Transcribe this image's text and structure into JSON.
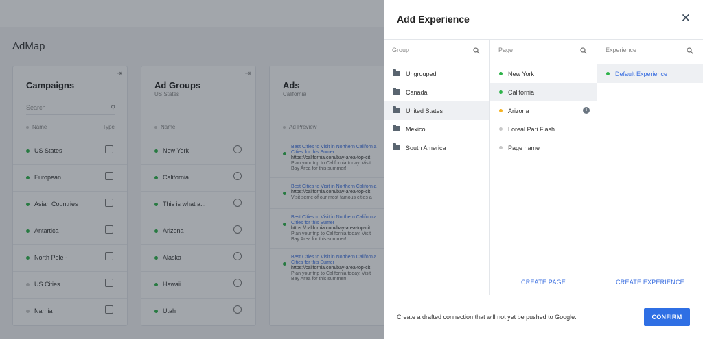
{
  "app": {
    "title": "AdMap"
  },
  "campaigns": {
    "title": "Campaigns",
    "search_placeholder": "Search",
    "col_name": "Name",
    "col_type": "Type",
    "rows": [
      {
        "label": "US States",
        "status": "#2eb34a"
      },
      {
        "label": "European",
        "status": "#2eb34a"
      },
      {
        "label": "Asian Countries",
        "status": "#2eb34a"
      },
      {
        "label": "Antartica",
        "status": "#2eb34a"
      },
      {
        "label": "North Pole -",
        "status": "#2eb34a"
      },
      {
        "label": "US Cities",
        "status": "#c8c8c8"
      },
      {
        "label": "Narnia",
        "status": "#c8c8c8"
      }
    ]
  },
  "ad_groups": {
    "title": "Ad Groups",
    "subtitle": "US States",
    "col_name": "Name",
    "rows": [
      {
        "label": "New York",
        "status": "#2eb34a"
      },
      {
        "label": "California",
        "status": "#2eb34a"
      },
      {
        "label": "This is what a...",
        "status": "#2eb34a"
      },
      {
        "label": "Arizona",
        "status": "#2eb34a"
      },
      {
        "label": "Alaska",
        "status": "#2eb34a"
      },
      {
        "label": "Hawaii",
        "status": "#2eb34a"
      },
      {
        "label": "Utah",
        "status": "#2eb34a"
      }
    ]
  },
  "ads": {
    "title": "Ads",
    "subtitle": "California",
    "col_preview": "Ad Preview",
    "rows": [
      {
        "headline": "Best Cities to Visit in Northern California",
        "headline2": "Cities for this Sumer",
        "url": "https://california.com/bay-area-top-cit",
        "desc": "Plan your trip to California today. Visit",
        "desc2": "Bay Area for this summer!"
      },
      {
        "headline": "Best Cities to Visit in Northern California",
        "headline2": "",
        "url": "https://california.com/bay-area-top-cit",
        "desc": "Visit some of our most famous cities a",
        "desc2": ""
      },
      {
        "headline": "Best Cities to Visit in Northern California",
        "headline2": "Cities for this Sumer",
        "url": "https://california.com/bay-area-top-cit",
        "desc": "Plan your trip to California today. Visit",
        "desc2": "Bay Area for this summer!"
      },
      {
        "headline": "Best Cities to Visit in Northern California",
        "headline2": "Cities for this Sumer",
        "url": "https://california.com/bay-area-top-cit",
        "desc": "Plan your trip to California today. Visit",
        "desc2": "Bay Area for this summer!"
      }
    ]
  },
  "dialog": {
    "title": "Add Experience",
    "group_placeholder": "Group",
    "page_placeholder": "Page",
    "experience_placeholder": "Experience",
    "groups": [
      "Ungrouped",
      "Canada",
      "United States",
      "Mexico",
      "South America"
    ],
    "selected_group": "United States",
    "pages": [
      {
        "label": "New York",
        "status": "#2eb34a"
      },
      {
        "label": "California",
        "status": "#2eb34a"
      },
      {
        "label": "Arizona",
        "status": "#f5b324"
      },
      {
        "label": "Loreal Pari Flash...",
        "status": "#c8c8c8"
      },
      {
        "label": "Page name",
        "status": "#c8c8c8"
      }
    ],
    "selected_page": "California",
    "experiences": [
      {
        "label": "Default Experience",
        "status": "#2eb34a"
      }
    ],
    "create_page_label": "CREATE PAGE",
    "create_experience_label": "CREATE EXPERIENCE",
    "footer_text": "Create a drafted connection that will not yet be pushed to Google.",
    "confirm_label": "CONFIRM"
  }
}
